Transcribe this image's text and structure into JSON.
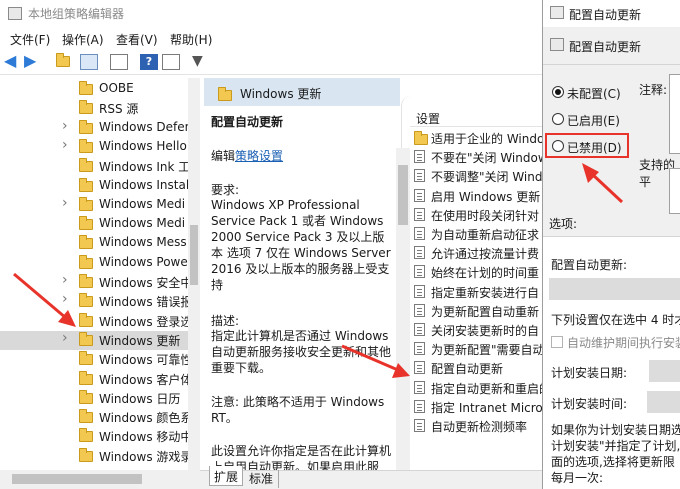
{
  "window_title": "本地组策略编辑器",
  "menu": [
    "文件(F)",
    "操作(A)",
    "查看(V)",
    "帮助(H)"
  ],
  "tree_items": [
    {
      "label": "OOBE",
      "expand": false
    },
    {
      "label": "RSS 源",
      "expand": false
    },
    {
      "label": "Windows Defen",
      "expand": true
    },
    {
      "label": "Windows Hello",
      "expand": true
    },
    {
      "label": "Windows Ink 工",
      "expand": false
    },
    {
      "label": "Windows Install",
      "expand": false
    },
    {
      "label": "Windows Medi",
      "expand": true
    },
    {
      "label": "Windows Medi",
      "expand": false
    },
    {
      "label": "Windows Mess",
      "expand": false
    },
    {
      "label": "Windows Powe",
      "expand": false
    },
    {
      "label": "Windows 安全中",
      "expand": true
    },
    {
      "label": "Windows 错误报",
      "expand": true
    },
    {
      "label": "Windows 登录选",
      "expand": false
    },
    {
      "label": "Windows 更新",
      "expand": true,
      "selected": true
    },
    {
      "label": "Windows 可靠性",
      "expand": false
    },
    {
      "label": "Windows 客户体",
      "expand": false
    },
    {
      "label": "Windows 日历",
      "expand": false
    },
    {
      "label": "Windows 颜色系",
      "expand": false
    },
    {
      "label": "Windows 移动中",
      "expand": false
    },
    {
      "label": "Windows 游戏录",
      "expand": false
    }
  ],
  "middle": {
    "header": "Windows 更新",
    "policy_title": "配置自动更新",
    "edit_prefix": "编辑",
    "edit_link": "策略设置",
    "req_label": "要求:",
    "req_text": "Windows XP Professional Service Pack 1 或者 Windows 2000 Service Pack 3 及以上版本 选项 7 仅在 Windows Server 2016 及以上版本的服务器上受支持",
    "desc_label": "描述:",
    "desc_text": "指定此计算机是否通过 Windows 自动更新服务接收安全更新和其他重要下载。",
    "note_text": "注意: 此策略不适用于 Windows RT。",
    "extra_text": "此设置允许你指定是否在此计算机上启用自动更新。如果启用此服",
    "tab_expand": "扩展",
    "tab_standard": "标准"
  },
  "settings": {
    "header": "设置",
    "items": [
      {
        "label": "适用于企业的 Windo",
        "type": "folder"
      },
      {
        "label": "不要在\"关闭 Window",
        "type": "doc"
      },
      {
        "label": "不要调整\"关闭 Windo",
        "type": "doc"
      },
      {
        "label": "启用 Windows 更新",
        "type": "doc"
      },
      {
        "label": "在使用时段关闭针对",
        "type": "doc"
      },
      {
        "label": "为自动重新启动征求",
        "type": "doc"
      },
      {
        "label": "允许通过按流量计费",
        "type": "doc"
      },
      {
        "label": "始终在计划的时间重",
        "type": "doc"
      },
      {
        "label": "指定重新安装进行自",
        "type": "doc"
      },
      {
        "label": "为更新配置自动重新",
        "type": "doc"
      },
      {
        "label": "关闭安装更新时的自",
        "type": "doc"
      },
      {
        "label": "为更新配置\"需要自动",
        "type": "doc"
      },
      {
        "label": "配置自动更新",
        "type": "doc",
        "highlight": true
      },
      {
        "label": "指定自动更新和重启的",
        "type": "doc"
      },
      {
        "label": "指定 Intranet Micro",
        "type": "doc"
      },
      {
        "label": "自动更新检测频率",
        "type": "doc"
      }
    ]
  },
  "dialog": {
    "title": "配置自动更新",
    "sub_title": "配置自动更新",
    "radio_not_configured": "未配置(C)",
    "radio_enabled": "已启用(E)",
    "radio_disabled": "已禁用(D)",
    "comment_label": "注释:",
    "supported_label": "支持的平",
    "options_label": "选项:",
    "auto_update_label": "配置自动更新:",
    "note_4h": "下列设置仅在选中 4 时才",
    "maint_label": "自动维护期间执行安装",
    "sched_date": "计划安装日期:",
    "sched_time": "计划安装时间:",
    "bottom_text1": "如果你为计划安装日期选",
    "bottom_text2": "计划安装\"并指定了计划,",
    "bottom_text3": "面的选项,选择将更新限",
    "bottom_text4": "每月一次:"
  }
}
